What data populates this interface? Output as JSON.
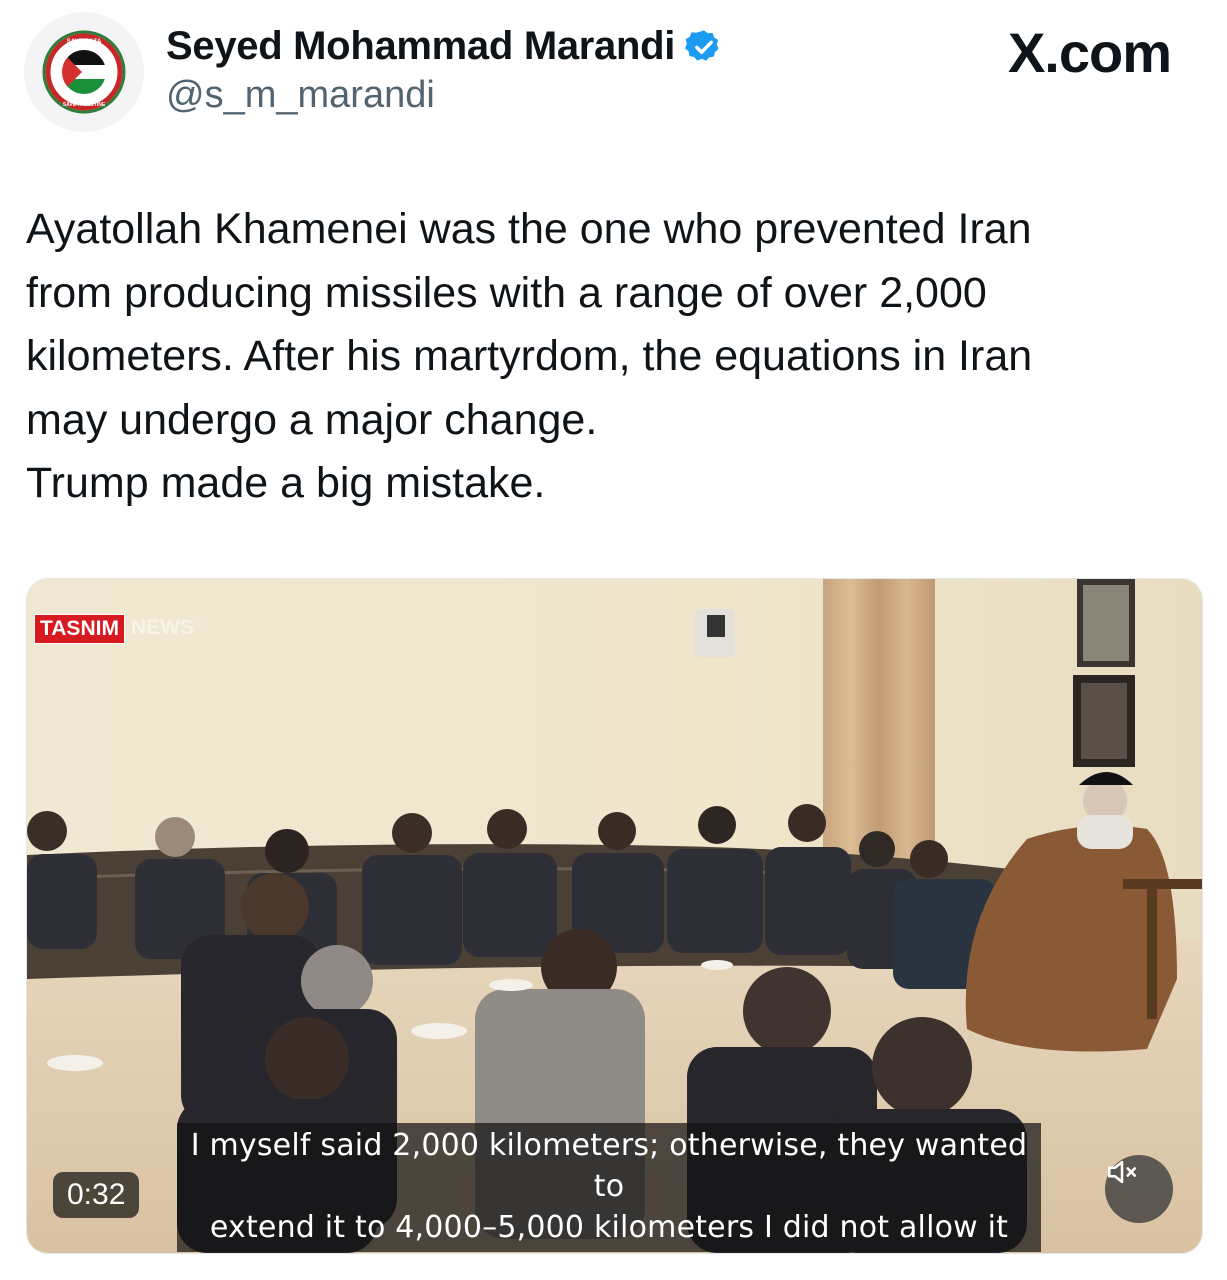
{
  "author": {
    "display_name": "Seyed Mohammad Marandi",
    "handle": "@s_m_marandi",
    "avatar_top_text": "SAVE GAZA",
    "avatar_bottom_text": "SAVE PALESTINE"
  },
  "site_logo": "X.com",
  "tweet": {
    "lines": [
      "Ayatollah Khamenei was the one who prevented Iran",
      "from producing missiles with a range of over 2,000",
      "kilometers. After his martyrdom, the equations in Iran",
      "may undergo a major change.",
      "Trump made a big mistake."
    ]
  },
  "video": {
    "watermark_brand": "TASNIM",
    "watermark_suffix": "NEWS",
    "subtitle_line1": "I myself said 2,000 kilometers; otherwise, they wanted to",
    "subtitle_line2": "extend it to 4,000–5,000 kilometers I did not allow it",
    "timestamp": "0:32",
    "mute_icon": "speaker-muted-icon"
  },
  "colors": {
    "verified": "#1d9bf0",
    "text": "#0f1419",
    "secondary": "#536471",
    "tasnim_red": "#d71920"
  }
}
